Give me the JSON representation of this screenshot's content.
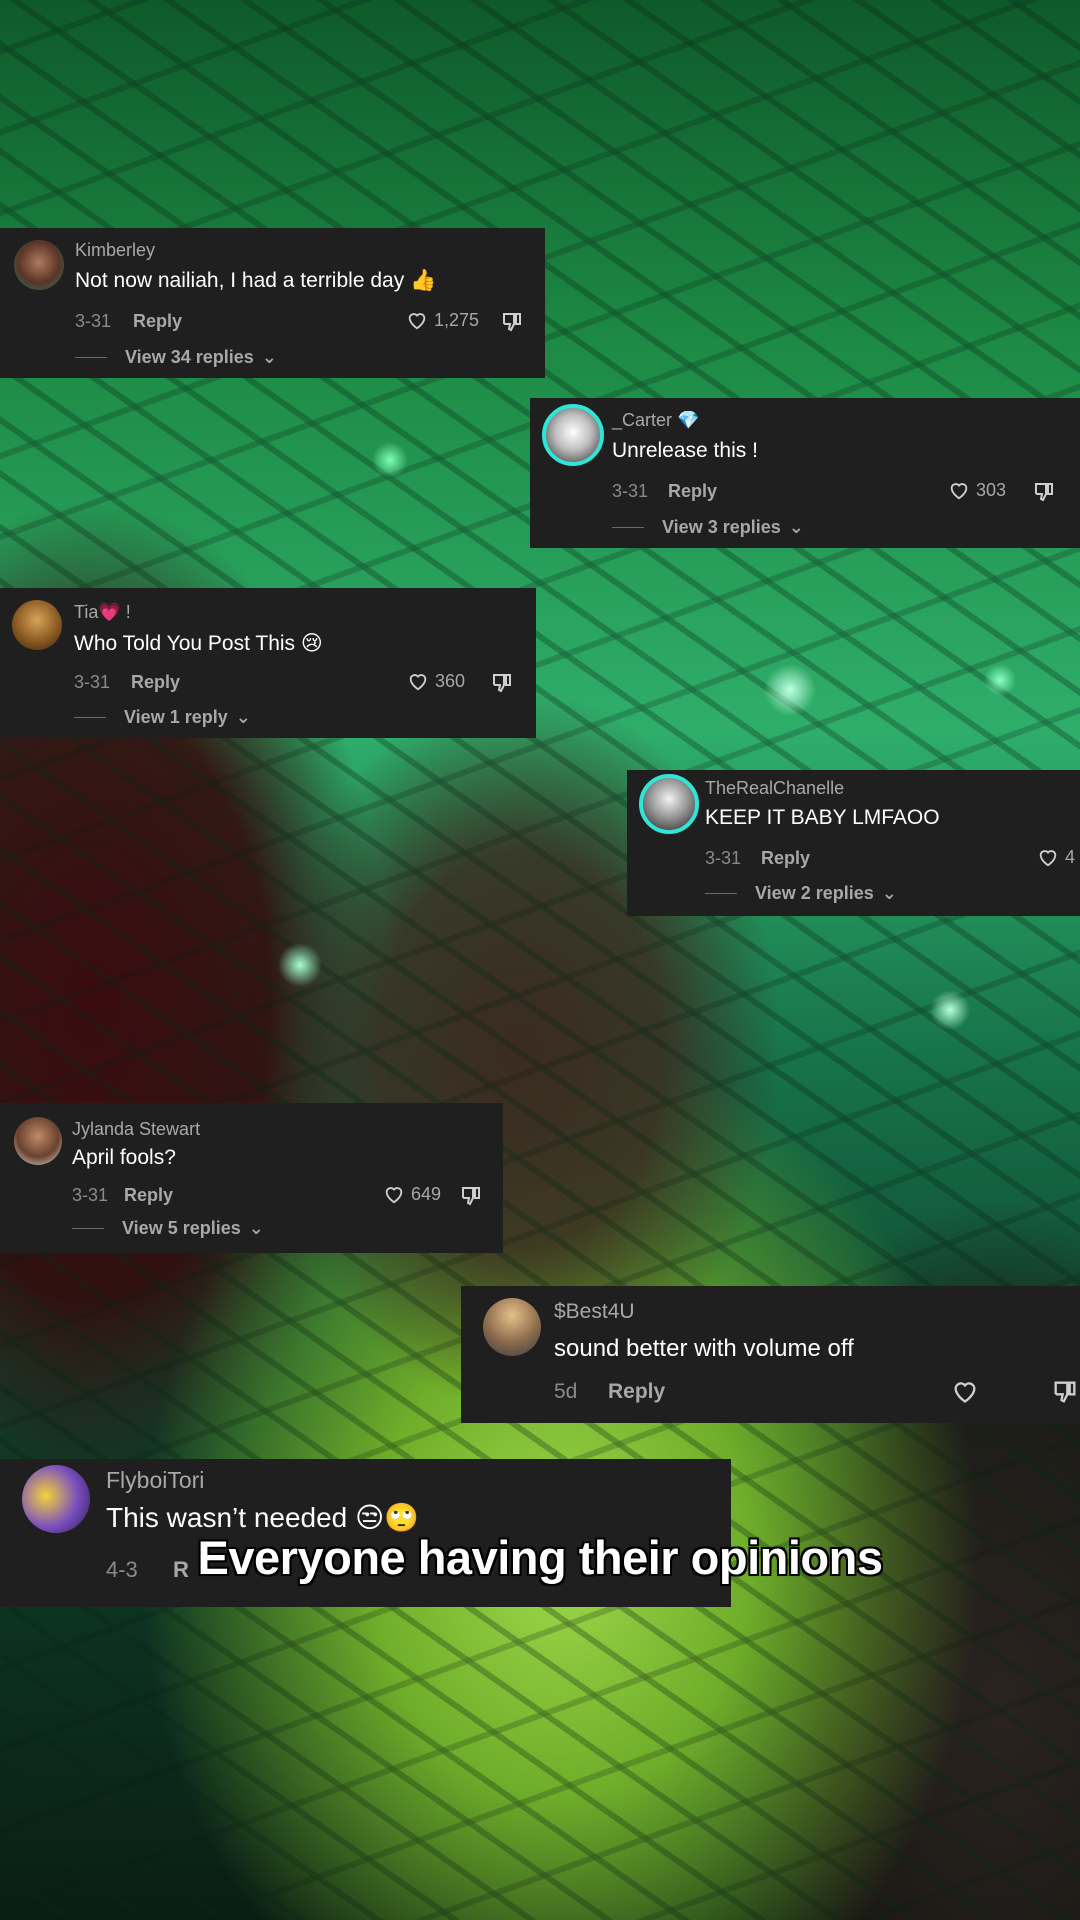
{
  "caption": "Everyone having their opinions",
  "comments": [
    {
      "name": "Kimberley",
      "text": "Not now nailiah, I had a terrible day 👍",
      "date": "3-31",
      "reply": "Reply",
      "likes": "1,275",
      "view_replies": "View 34 replies"
    },
    {
      "name": "_Carter 💎",
      "text": "Unrelease this !",
      "date": "3-31",
      "reply": "Reply",
      "likes": "303",
      "view_replies": "View 3 replies"
    },
    {
      "name": "Tia💗 !",
      "text": "Who Told You Post This 😢",
      "date": "3-31",
      "reply": "Reply",
      "likes": "360",
      "view_replies": "View 1 reply"
    },
    {
      "name": "TheRealChanelle",
      "text": "KEEP IT BABY LMFAOO",
      "date": "3-31",
      "reply": "Reply",
      "likes": "4",
      "view_replies": "View 2 replies"
    },
    {
      "name": "Jylanda Stewart",
      "text": "April fools?",
      "date": "3-31",
      "reply": "Reply",
      "likes": "649",
      "view_replies": "View 5 replies"
    },
    {
      "name": "$Best4U",
      "text": "sound better with volume off",
      "date": "5d",
      "reply": "Reply",
      "likes": ""
    },
    {
      "name": "FlyboiTori",
      "text": "This wasn’t needed 😒🙄",
      "date": "4-3",
      "reply": "R"
    }
  ]
}
